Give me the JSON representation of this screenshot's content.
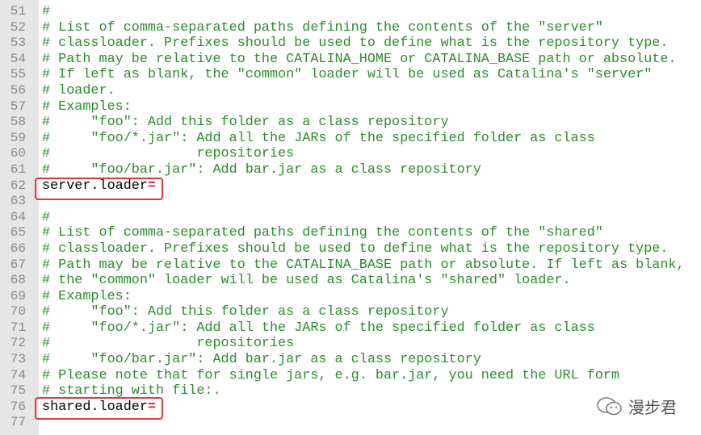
{
  "editor": {
    "lines": [
      {
        "num": "51",
        "text": "#",
        "type": "comment"
      },
      {
        "num": "52",
        "text": "# List of comma-separated paths defining the contents of the \"server\"",
        "type": "comment"
      },
      {
        "num": "53",
        "text": "# classloader. Prefixes should be used to define what is the repository type.",
        "type": "comment"
      },
      {
        "num": "54",
        "text": "# Path may be relative to the CATALINA_HOME or CATALINA_BASE path or absolute.",
        "type": "comment"
      },
      {
        "num": "55",
        "text": "# If left as blank, the \"common\" loader will be used as Catalina's \"server\"",
        "type": "comment"
      },
      {
        "num": "56",
        "text": "# loader.",
        "type": "comment"
      },
      {
        "num": "57",
        "text": "# Examples:",
        "type": "comment"
      },
      {
        "num": "58",
        "text": "#     \"foo\": Add this folder as a class repository",
        "type": "comment"
      },
      {
        "num": "59",
        "text": "#     \"foo/*.jar\": Add all the JARs of the specified folder as class",
        "type": "comment"
      },
      {
        "num": "60",
        "text": "#                  repositories",
        "type": "comment"
      },
      {
        "num": "61",
        "text": "#     \"foo/bar.jar\": Add bar.jar as a class repository",
        "type": "comment"
      },
      {
        "num": "62",
        "text": "server.loader",
        "eq": "=",
        "type": "code"
      },
      {
        "num": "63",
        "text": "",
        "type": "code"
      },
      {
        "num": "64",
        "text": "#",
        "type": "comment"
      },
      {
        "num": "65",
        "text": "# List of comma-separated paths defining the contents of the \"shared\"",
        "type": "comment"
      },
      {
        "num": "66",
        "text": "# classloader. Prefixes should be used to define what is the repository type.",
        "type": "comment"
      },
      {
        "num": "67",
        "text": "# Path may be relative to the CATALINA_BASE path or absolute. If left as blank,",
        "type": "comment"
      },
      {
        "num": "68",
        "text": "# the \"common\" loader will be used as Catalina's \"shared\" loader.",
        "type": "comment"
      },
      {
        "num": "69",
        "text": "# Examples:",
        "type": "comment"
      },
      {
        "num": "70",
        "text": "#     \"foo\": Add this folder as a class repository",
        "type": "comment"
      },
      {
        "num": "71",
        "text": "#     \"foo/*.jar\": Add all the JARs of the specified folder as class",
        "type": "comment"
      },
      {
        "num": "72",
        "text": "#                  repositories",
        "type": "comment"
      },
      {
        "num": "73",
        "text": "#     \"foo/bar.jar\": Add bar.jar as a class repository",
        "type": "comment"
      },
      {
        "num": "74",
        "text": "# Please note that for single jars, e.g. bar.jar, you need the URL form",
        "type": "comment"
      },
      {
        "num": "75",
        "text": "# starting with file:.",
        "type": "comment"
      },
      {
        "num": "76",
        "text": "shared.loader",
        "eq": "=",
        "type": "code"
      },
      {
        "num": "77",
        "text": "",
        "type": "code"
      }
    ],
    "highlighted_lines": [
      "62",
      "76"
    ],
    "colors": {
      "comment": "#2e8b2e",
      "highlight_box": "#e5343c",
      "equals": "#e0202a",
      "gutter": "#e6e6e6"
    }
  },
  "watermark": {
    "icon": "wechat-icon",
    "text": "漫步君"
  }
}
